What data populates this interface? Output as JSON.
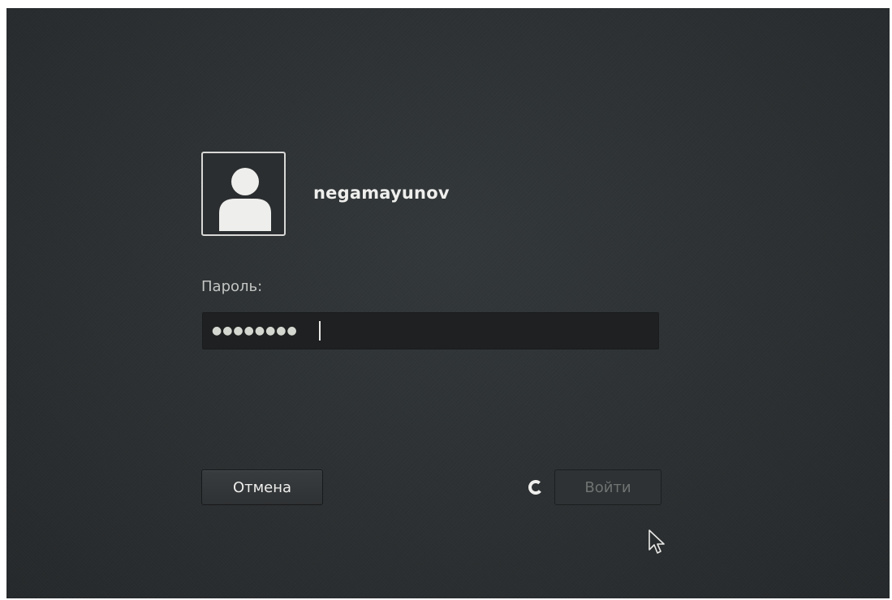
{
  "login": {
    "username": "negamayunov",
    "password_label": "Пароль:",
    "password_masked": "●●●●●●●●",
    "cancel_label": "Отмена",
    "login_label": "Войти"
  },
  "icons": {
    "avatar": "user-avatar-icon",
    "spinner": "loading-spinner-icon",
    "cursor": "mouse-pointer-icon"
  },
  "colors": {
    "background": "#2c3032",
    "text": "#eeeeec",
    "field": "#1e2021",
    "disabled_text": "#6f7371"
  }
}
